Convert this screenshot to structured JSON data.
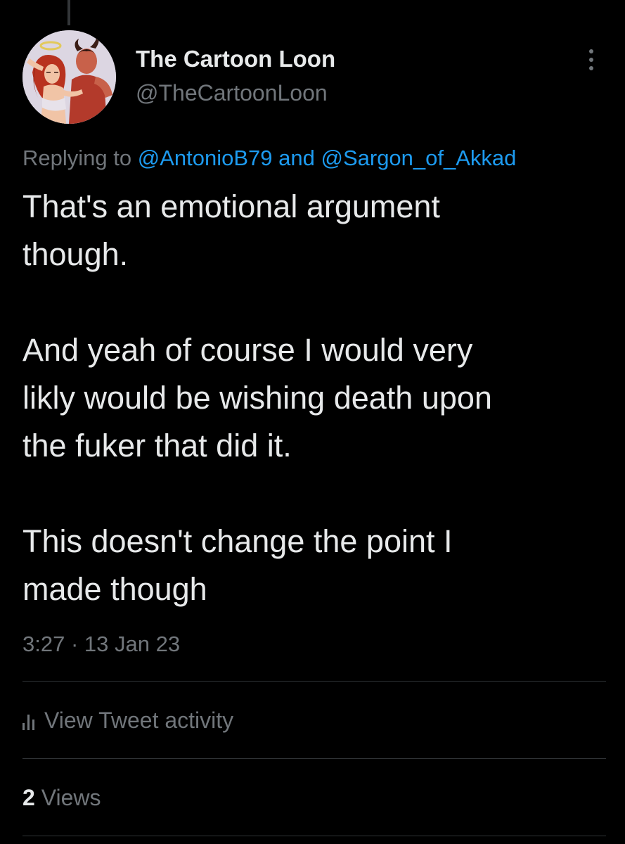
{
  "author": {
    "display_name": "The Cartoon Loon",
    "handle": "@TheCartoonLoon"
  },
  "reply_to": {
    "prefix": "Replying to",
    "mention_1": "@AntonioB79",
    "joiner": "and",
    "mention_2": "@Sargon_of_Akkad"
  },
  "tweet": {
    "paragraphs": [
      "That's an emotional argument\nthough.",
      "And yeah of course I would very\nlikly would be wishing death upon\nthe fuker that did it.",
      "This doesn't change the point I\nmade though"
    ],
    "timestamp": "3:27 · 13 Jan 23"
  },
  "activity": {
    "label": "View Tweet activity"
  },
  "views": {
    "count": "2",
    "label": "Views"
  },
  "icons": {
    "more": "more-vertical-icon",
    "activity": "bar-chart-icon"
  },
  "colors": {
    "background": "#000000",
    "text_primary": "#e7e9ea",
    "text_secondary": "#71767b",
    "link": "#1d9bf0",
    "divider": "#2f3336"
  }
}
